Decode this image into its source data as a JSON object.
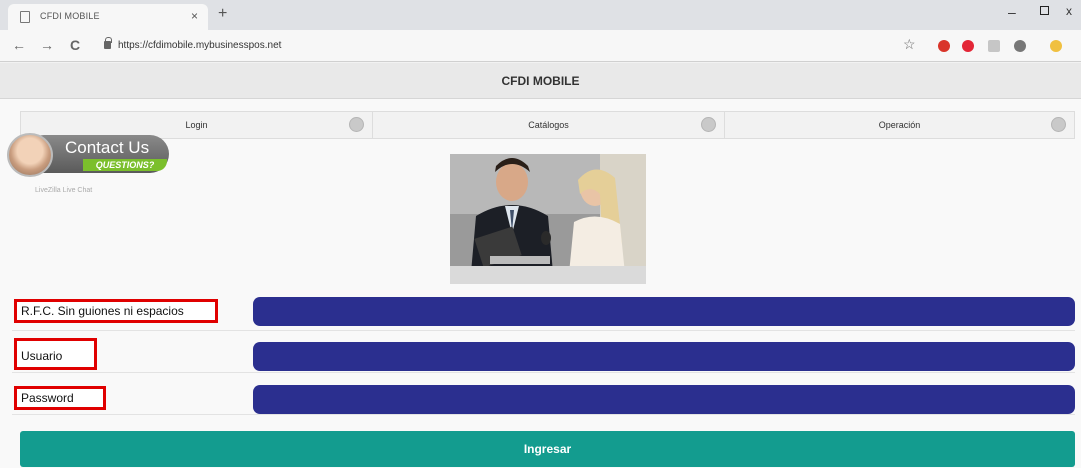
{
  "browser": {
    "tab_title": "CFDI MOBILE",
    "tab_close": "×",
    "new_tab": "+",
    "url": "https://cfdimobile.mybusinesspos.net",
    "nav_back": "←",
    "nav_forward": "→",
    "nav_reload": "C",
    "star": "☆",
    "min": "–",
    "close": "x"
  },
  "header": {
    "title": "CFDI MOBILE"
  },
  "nav": {
    "items": [
      {
        "label": "Login",
        "icon": "home-icon"
      },
      {
        "label": "Catálogos",
        "icon": "grid-icon"
      },
      {
        "label": "Operación",
        "icon": "gear-icon"
      }
    ]
  },
  "contact": {
    "title": "Contact Us",
    "subtitle": "QUESTIONS?",
    "caption": "LiveZilla Live Chat"
  },
  "form": {
    "rfc_label": "R.F.C. Sin guiones ni espacios",
    "usuario_label": "Usuario",
    "password_label": "Password",
    "submit_label": "Ingresar"
  },
  "colors": {
    "input_bg": "#2b2f8f",
    "submit_bg": "#139c8f",
    "label_border": "#e00000"
  }
}
